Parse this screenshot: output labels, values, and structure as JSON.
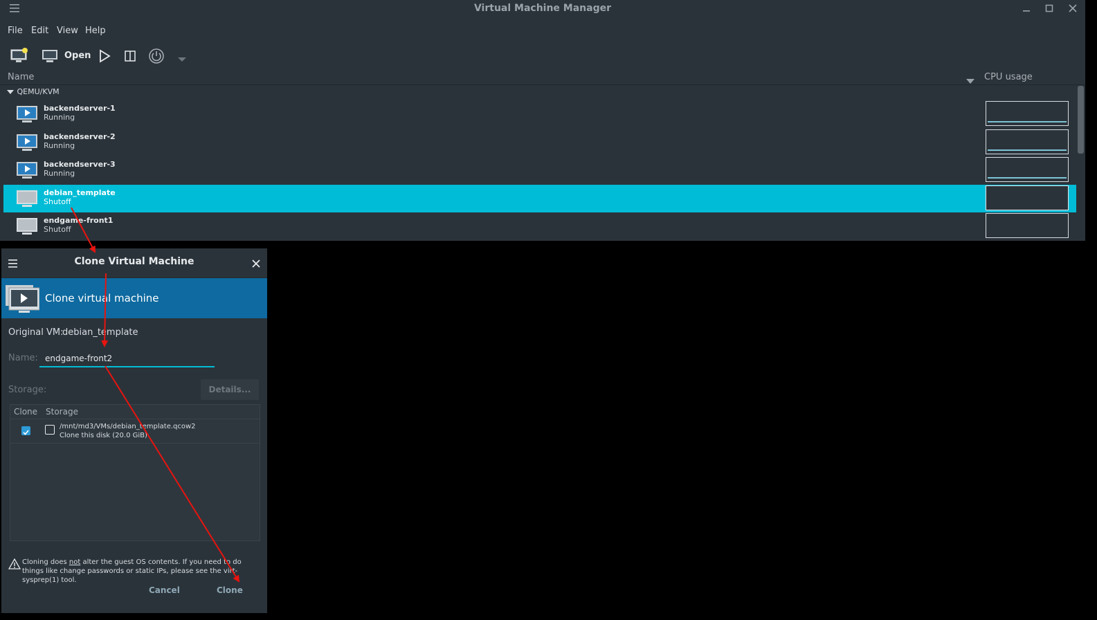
{
  "main_window": {
    "title": "Virtual Machine Manager",
    "menu": [
      "File",
      "Edit",
      "View",
      "Help"
    ],
    "toolbar": {
      "open_label": "Open"
    },
    "list_header": {
      "name": "Name",
      "cpu": "CPU usage"
    },
    "group": "QEMU/KVM",
    "vms": [
      {
        "name": "backendserver-1",
        "state": "Running"
      },
      {
        "name": "backendserver-2",
        "state": "Running"
      },
      {
        "name": "backendserver-3",
        "state": "Running"
      },
      {
        "name": "debian_template",
        "state": "Shutoff"
      },
      {
        "name": "endgame-front1",
        "state": "Shutoff"
      }
    ]
  },
  "clone_dialog": {
    "title": "Clone Virtual Machine",
    "banner": "Clone virtual machine",
    "original_label": "Original VM:",
    "original_value": "debian_template",
    "name_label": "Name:",
    "name_value": "endgame-front2",
    "storage_label": "Storage:",
    "details_button": "Details...",
    "table_headers": {
      "clone": "Clone",
      "storage": "Storage"
    },
    "disk_path": "/mnt/md3/VMs/debian_template.qcow2",
    "disk_desc": "Clone this disk (20.0 GiB)",
    "warning_pre": "Cloning does ",
    "warning_not": "not",
    "warning_post": " alter the guest OS contents. If you need to do things like change passwords or static IPs, please see the virt-sysprep(1) tool.",
    "cancel_button": "Cancel",
    "clone_button": "Clone"
  },
  "colors": {
    "selection": "#00bcd6",
    "banner": "#0e6aa0",
    "annotation_arrow": "#e8140f"
  }
}
